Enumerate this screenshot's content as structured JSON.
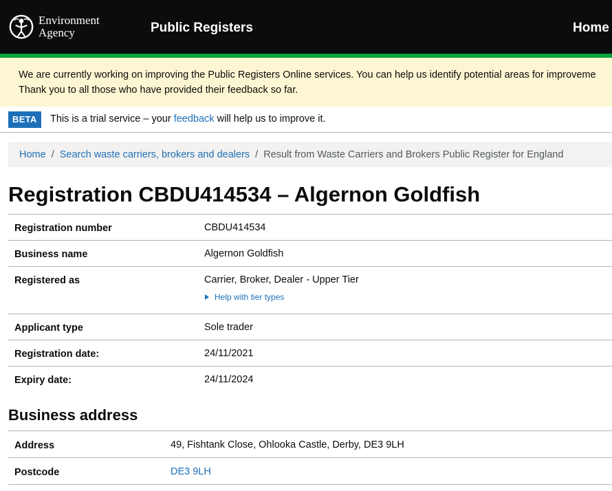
{
  "header": {
    "logo_text": "Environment\nAgency",
    "logo_icon": "environment-agency-logo-icon",
    "service_name": "Public Registers",
    "home_link": "Home"
  },
  "notice": {
    "line1": "We are currently working on improving the Public Registers Online services. You can help us identify potential areas for improveme",
    "line2": "Thank you to all those who have provided their feedback so far."
  },
  "beta": {
    "tag": "BETA",
    "text_before": "This is a trial service – your ",
    "link": "feedback",
    "text_after": " will help us to improve it."
  },
  "breadcrumb": {
    "home": "Home",
    "search": "Search waste carriers, brokers and dealers",
    "current": "Result from Waste Carriers and Brokers Public Register for England",
    "separator": "/"
  },
  "page_title": "Registration CBDU414534 – Algernon Goldfish",
  "registration": {
    "rows": [
      {
        "key": "Registration number",
        "value": "CBDU414534"
      },
      {
        "key": "Business name",
        "value": "Algernon Goldfish"
      },
      {
        "key": "Registered as",
        "value": "Carrier, Broker, Dealer - Upper Tier",
        "details": "Help with tier types"
      },
      {
        "key": "Applicant type",
        "value": "Sole trader"
      },
      {
        "key": "Registration date:",
        "value": "24/11/2021"
      },
      {
        "key": "Expiry date:",
        "value": "24/11/2024"
      }
    ]
  },
  "business_address": {
    "heading": "Business address",
    "rows": [
      {
        "key": "Address",
        "value": "49, Fishtank Close, Ohlooka Castle, Derby, DE3 9LH"
      },
      {
        "key": "Postcode",
        "value": "DE3 9LH"
      }
    ]
  },
  "colors": {
    "header_bg": "#0b0c0c",
    "header_stripe": "#00a33b",
    "notice_bg": "#fcf6d2",
    "link": "#1d70b8",
    "beta_tag_bg": "#1d70b8",
    "breadcrumb_bg": "#f3f2f1"
  }
}
